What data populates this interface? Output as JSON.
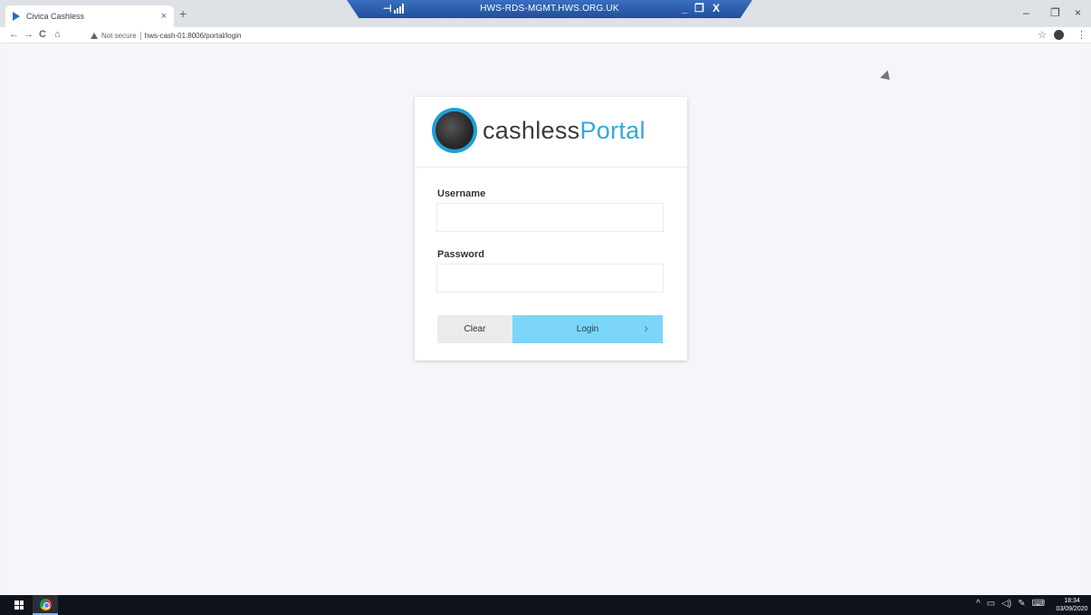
{
  "browser": {
    "tab_title": "Civica Cashless",
    "tab_close": "×",
    "new_tab": "+",
    "not_secure": "Not secure",
    "url": "hws-cash-01:8006/portal/login",
    "nav": {
      "back": "←",
      "forward": "→",
      "reload": "C",
      "home": "⌂"
    },
    "star": "☆",
    "menu": "⋮",
    "window_controls": {
      "minimize": "–",
      "restore": "❐",
      "close": "×"
    }
  },
  "rdp": {
    "title": "HWS-RDS-MGMT.HWS.ORG.UK",
    "minimize": "_",
    "restore": "❐",
    "close": "X"
  },
  "login": {
    "brand_part1": "cashless",
    "brand_part2": "Portal",
    "username_label": "Username",
    "password_label": "Password",
    "clear_label": "Clear",
    "login_label": "Login",
    "login_chevron": "›"
  },
  "taskbar": {
    "time": "18:34",
    "date": "03/09/2020",
    "tray_chevron": "^",
    "tray_icons": [
      "network-icon",
      "volume-icon",
      "pen-icon",
      "keyboard-icon"
    ]
  },
  "colors": {
    "brand_blue": "#34a9d9",
    "login_button": "#7bd6f9",
    "rdp_bar": "#2a5fae",
    "taskbar": "#10121c"
  }
}
